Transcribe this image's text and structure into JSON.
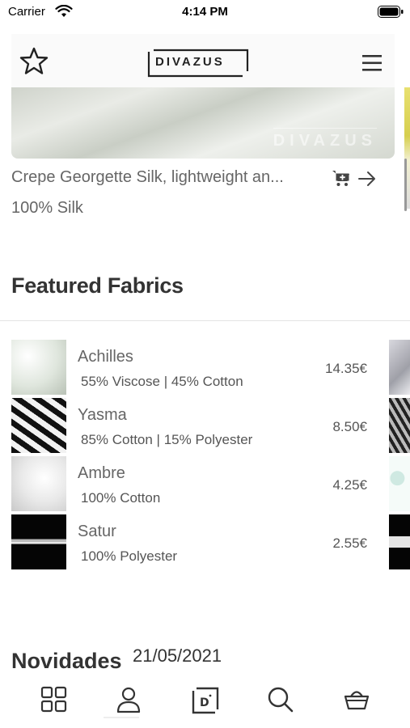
{
  "status_bar": {
    "carrier": "Carrier",
    "time": "4:14 PM"
  },
  "header": {
    "logo_text": "DIVAZUS",
    "favorite_icon": "star-icon",
    "menu_icon": "hamburger-icon"
  },
  "hero": {
    "watermark": "DIVAZUS",
    "title": "Crepe Georgette Silk, lightweight an...",
    "composition": "100% Silk",
    "cart_icon": "cart-add-icon",
    "arrow_icon": "arrow-right-icon"
  },
  "featured": {
    "title": "Featured Fabrics",
    "products": [
      {
        "name": "Achilles",
        "composition": "55% Viscose | 45% Cotton",
        "price": "14.35€"
      },
      {
        "name": "Yasma",
        "composition": "85% Cotton | 15% Polyester",
        "price": "8.50€"
      },
      {
        "name": "Ambre",
        "composition": "100% Cotton",
        "price": "4.25€"
      },
      {
        "name": "Satur",
        "composition": "100% Polyester",
        "price": "2.55€"
      }
    ]
  },
  "novidades": {
    "title": "Novidades",
    "date": "21/05/2021"
  },
  "tab_bar": {
    "tabs": [
      "grid-icon",
      "user-icon",
      "divazus-logo-icon",
      "search-icon",
      "basket-icon"
    ]
  },
  "colors": {
    "text_primary": "#333333",
    "text_secondary": "#666666",
    "background": "#ffffff"
  }
}
